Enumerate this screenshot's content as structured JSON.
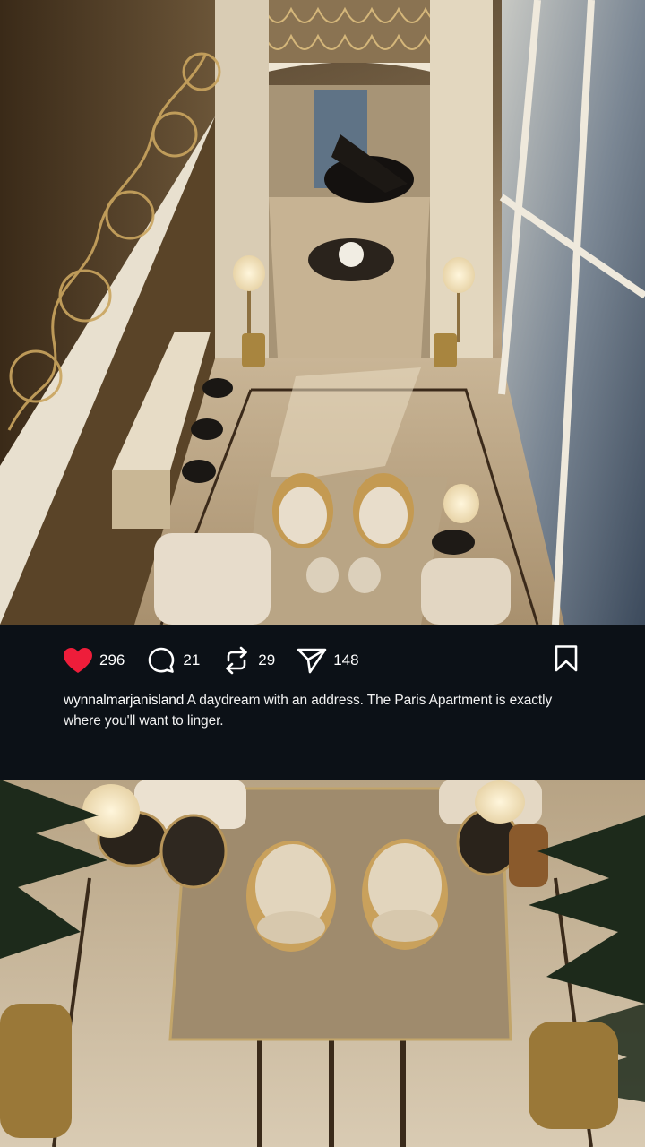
{
  "post": {
    "image_alt": "Aerial view of luxury duplex living room with grand piano and sea view",
    "likes": "296",
    "comments": "21",
    "reposts": "29",
    "shares": "148",
    "username": "wynnalmarjanisland",
    "caption": " A daydream with an address. The Paris Apartment is exactly where you'll want to linger."
  },
  "icons": {
    "like": "heart-icon",
    "comment": "comment-bubble-icon",
    "repost": "repost-icon",
    "share": "send-icon",
    "save": "bookmark-icon"
  },
  "colors": {
    "like_active": "#ee1d3a",
    "bar_background": "#0c1117",
    "text": "#ffffff"
  }
}
